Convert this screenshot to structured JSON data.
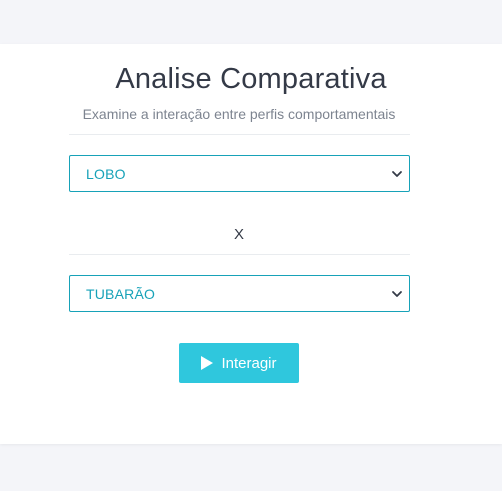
{
  "header": {
    "title": "Analise Comparativa",
    "subtitle": "Examine a interação entre perfis comportamentais"
  },
  "form": {
    "profile_a": {
      "selected": "LOBO",
      "icon": "chevron-down-icon"
    },
    "separator": "X",
    "profile_b": {
      "selected": "TUBARÃO",
      "icon": "chevron-down-icon"
    },
    "action": {
      "label": "Interagir",
      "icon": "play-icon"
    }
  },
  "colors": {
    "page_background": "#f4f5f9",
    "accent": "#17a2b8",
    "button_background": "#2fc7dd",
    "title_text": "#343a47",
    "subtitle_text": "#7d8490"
  }
}
